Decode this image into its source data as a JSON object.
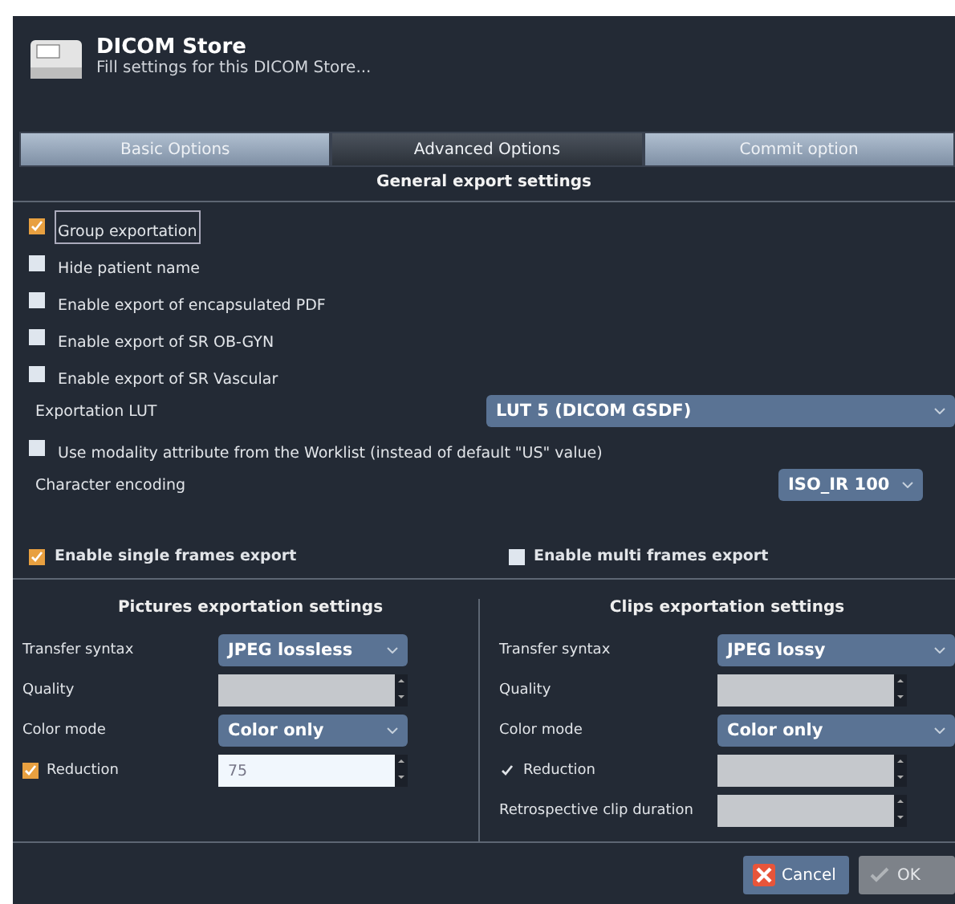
{
  "dialog": {
    "title": "DICOM Store",
    "subtitle": "Fill settings for this DICOM Store..."
  },
  "tabs": [
    {
      "label": "Basic Options",
      "selected": false
    },
    {
      "label": "Advanced Options",
      "selected": true
    },
    {
      "label": "Commit option",
      "selected": false
    }
  ],
  "section_title": "General export settings",
  "options": [
    {
      "kind": "check",
      "label": "Group exportation",
      "checked": true,
      "focused": true
    },
    {
      "kind": "check",
      "label": "Hide patient name",
      "checked": false,
      "focused": false
    },
    {
      "kind": "check",
      "label": "Enable export of encapsulated PDF",
      "checked": false,
      "focused": false
    },
    {
      "kind": "check",
      "label": "Enable export of SR OB-GYN",
      "checked": false,
      "focused": false
    },
    {
      "kind": "check",
      "label": "Enable export of SR Vascular",
      "checked": false,
      "focused": false
    },
    {
      "kind": "select",
      "label": "Exportation LUT",
      "value": "LUT 5 (DICOM GSDF)",
      "wide": true
    },
    {
      "kind": "check",
      "label": "Use modality attribute from the Worklist (instead of default \"US\" value)",
      "checked": false,
      "focused": false
    },
    {
      "kind": "select",
      "label": "Character encoding",
      "value": "ISO_IR 100",
      "wide": false
    }
  ],
  "frames": [
    {
      "label": "Enable single frames export",
      "checked": true
    },
    {
      "label": "Enable multi frames export",
      "checked": false
    }
  ],
  "panels": [
    {
      "title": "Pictures exportation settings",
      "rows": [
        {
          "kind": "select",
          "label": "Transfer syntax",
          "value": "JPEG lossless"
        },
        {
          "kind": "spin",
          "label": "Quality",
          "disabled": true
        },
        {
          "kind": "select",
          "label": "Color mode",
          "value": "Color only"
        },
        {
          "kind": "check-spin",
          "label": "Reduction",
          "checked": true,
          "disabled": false,
          "value": "75"
        }
      ]
    },
    {
      "title": "Clips exportation settings",
      "rows": [
        {
          "kind": "select",
          "label": "Transfer syntax",
          "value": "JPEG lossy"
        },
        {
          "kind": "spin",
          "label": "Quality",
          "disabled": true
        },
        {
          "kind": "select",
          "label": "Color mode",
          "value": "Color only"
        },
        {
          "kind": "check-spin",
          "label": "Reduction",
          "checked": true,
          "disabled": true
        },
        {
          "kind": "spin",
          "label": "Retrospective clip duration",
          "disabled": true
        }
      ]
    }
  ],
  "buttons": [
    {
      "label": "Cancel",
      "disabled": false
    },
    {
      "label": "OK",
      "disabled": true
    }
  ]
}
